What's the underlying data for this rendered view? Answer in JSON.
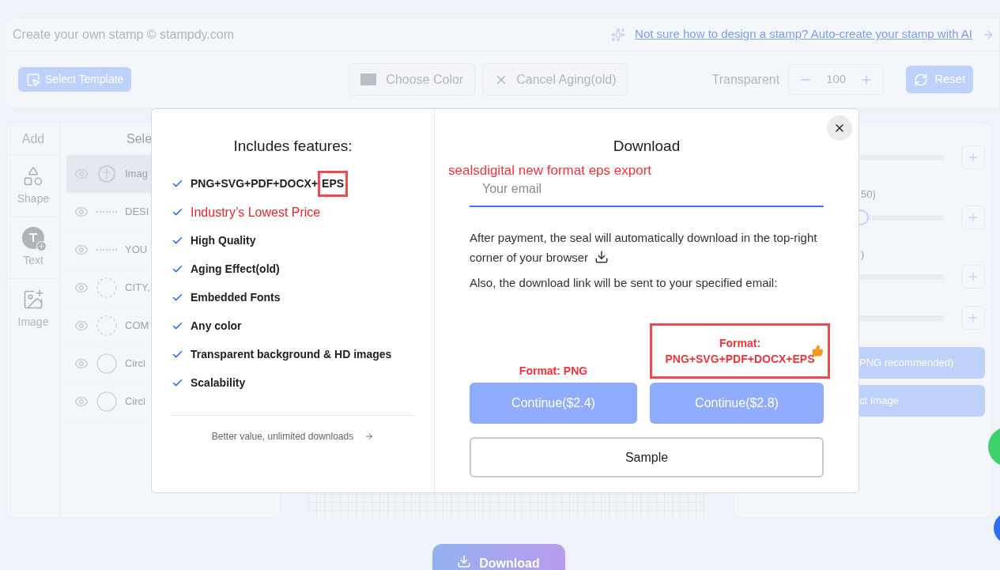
{
  "header": {
    "title": "Create your own stamp © stampdy.com",
    "ai_link": "Not sure how to design a stamp? Auto-create your stamp with AI"
  },
  "toolbar": {
    "select_template": "Select Template",
    "choose_color": "Choose Color",
    "cancel_aging": "Cancel Aging(old)",
    "transparent_label": "Transparent",
    "transparent_value": "100",
    "reset": "Reset"
  },
  "add_panel": {
    "title": "Add",
    "items": [
      {
        "kind": "shape",
        "label": "Shape"
      },
      {
        "kind": "text",
        "label": "Text"
      },
      {
        "kind": "image",
        "label": "Image"
      }
    ]
  },
  "layers": {
    "title": "Sele",
    "rows": [
      {
        "kind": "emblem",
        "label": "Imag",
        "selected": true
      },
      {
        "kind": "line",
        "label": "DESI",
        "selected": false
      },
      {
        "kind": "line",
        "label": "YOU",
        "selected": false
      },
      {
        "kind": "dashed-circle",
        "label": "CITY,",
        "selected": false
      },
      {
        "kind": "dashed-circle",
        "label": "COM",
        "selected": false
      },
      {
        "kind": "circle",
        "label": "Circl",
        "selected": false
      },
      {
        "kind": "circle",
        "label": "Circl",
        "selected": false
      }
    ]
  },
  "settings": {
    "rows": [
      {},
      {
        "label": "50)",
        "level": 0.59
      },
      {
        "label": ")"
      },
      {}
    ],
    "buttons": [
      "PNG recommended)",
      "ct Image"
    ]
  },
  "download_button": "Download",
  "modal": {
    "features_title": "Includes features:",
    "features": [
      {
        "label": "PNG+SVG+PDF+DOCX+",
        "boxed": "EPS",
        "emphasis": false
      },
      {
        "label": "Industry’s Lowest Price",
        "emphasis": true
      },
      {
        "label": "High Quality",
        "emphasis": false
      },
      {
        "label": "Aging Effect(old)",
        "emphasis": false
      },
      {
        "label": "Embedded Fonts",
        "emphasis": false
      },
      {
        "label": "Any color",
        "emphasis": false
      },
      {
        "label": "Transparent background & HD images",
        "emphasis": false
      },
      {
        "label": "Scalability",
        "emphasis": false
      }
    ],
    "better_value": "Better value, unlimited downloads",
    "download_title": "Download",
    "annotation": "sealsdigital new format eps export",
    "email_placeholder": "Your email",
    "payment_note": "After payment, the seal will automatically download in the top-right corner of your browser",
    "email_note": "Also, the download link will be sent to your specified email:",
    "options": [
      {
        "format": "Format: PNG",
        "button": "Continue($2.4)",
        "recommended": false
      },
      {
        "format": "Format:\nPNG+SVG+PDF+DOCX+EPS",
        "button": "Continue($2.8)",
        "recommended": true
      }
    ],
    "sample": "Sample"
  }
}
